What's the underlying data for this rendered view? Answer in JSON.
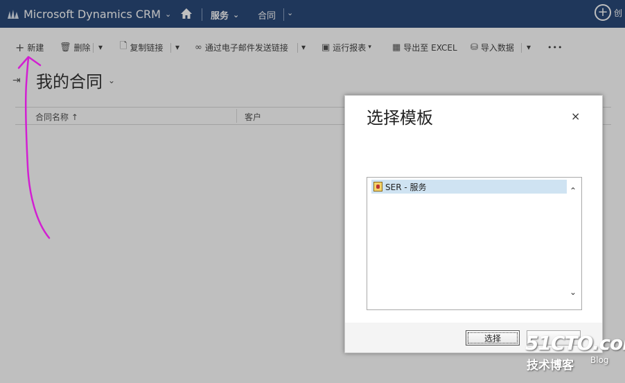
{
  "topnav": {
    "brand": "Microsoft Dynamics CRM",
    "area": "服务",
    "entity": "合同",
    "create_label": "创"
  },
  "commands": {
    "new": "新建",
    "delete": "删除",
    "copy_link": "复制链接",
    "email_link": "通过电子邮件发送链接",
    "run_report": "运行报表",
    "export_excel": "导出至 EXCEL",
    "import_data": "导入数据",
    "more": "•••"
  },
  "view": {
    "title": "我的合同"
  },
  "grid": {
    "columns": [
      "合同名称 ↑",
      "客户"
    ]
  },
  "dialog": {
    "title": "选择模板",
    "close": "×",
    "templates": [
      {
        "label": "SER - 服务",
        "selected": true
      }
    ],
    "select_button": "选择",
    "other_button": ""
  },
  "watermark": {
    "site": "51CTO.com",
    "tagline": "技术博客",
    "blog": "Blog"
  },
  "colors": {
    "nav_bg": "#2a4a7a",
    "selection": "#cfe3f2",
    "annotation": "#d21fd2"
  },
  "icons": {
    "brand": "dynamics-logo-icon",
    "home": "home-icon",
    "create": "plus-circle-icon"
  }
}
